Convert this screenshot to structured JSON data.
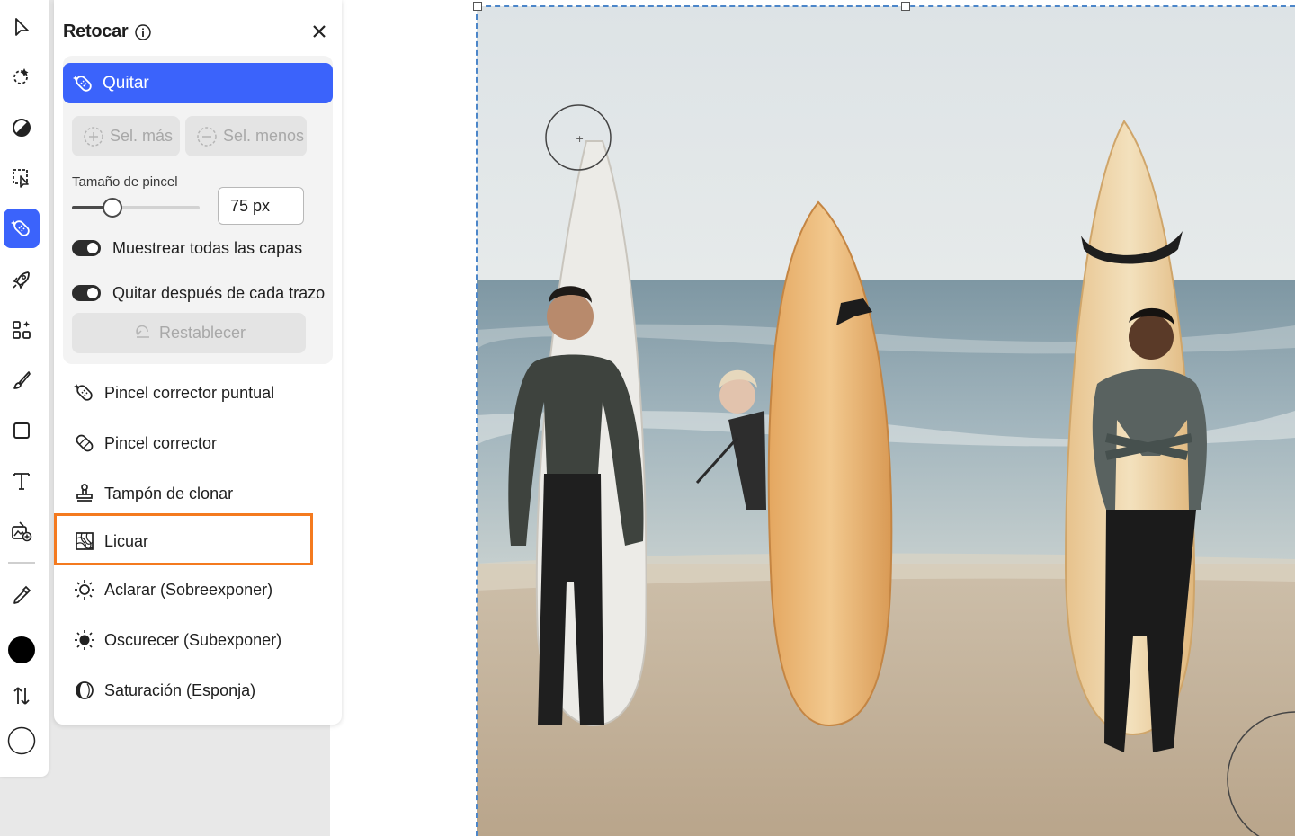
{
  "panel": {
    "title": "Retocar",
    "info_icon": "info-icon",
    "close_icon": "close-icon",
    "primary_tool": "Quitar",
    "sel_more": "Sel. más",
    "sel_less": "Sel. menos",
    "brush_size_label": "Tamaño de pincel",
    "brush_size_value": "75 px",
    "brush_size_slider_fraction": 0.3,
    "sample_all_layers": {
      "label": "Muestrear todas las capas",
      "on": true
    },
    "remove_after_stroke": {
      "label": "Quitar después de cada trazo",
      "on": true
    },
    "reset": "Restablecer",
    "tools": [
      {
        "label": "Pincel corrector puntual",
        "icon": "spot-healing-icon"
      },
      {
        "label": "Pincel corrector",
        "icon": "healing-bandage-icon"
      },
      {
        "label": "Tampón de clonar",
        "icon": "clone-stamp-icon"
      },
      {
        "label": "Licuar",
        "icon": "liquify-icon",
        "highlighted": true
      },
      {
        "label": "Aclarar (Sobreexponer)",
        "icon": "dodge-sun-icon"
      },
      {
        "label": "Oscurecer (Subexponer)",
        "icon": "burn-sun-icon"
      },
      {
        "label": "Saturación (Esponja)",
        "icon": "sponge-icon"
      }
    ]
  },
  "toolbar": {
    "tools": [
      "select-arrow-icon",
      "quick-select-icon",
      "adjust-icon",
      "object-select-icon",
      "retouch-icon",
      "quick-actions-rocket-icon",
      "generate-icon",
      "brush-icon",
      "shape-icon",
      "text-icon",
      "add-image-icon",
      "eyedropper-icon"
    ],
    "active": "retouch-icon",
    "foreground_color": "#000000",
    "background_color": "#ffffff"
  },
  "colors": {
    "accent": "#3b63fb",
    "highlight": "#f47a1f"
  }
}
